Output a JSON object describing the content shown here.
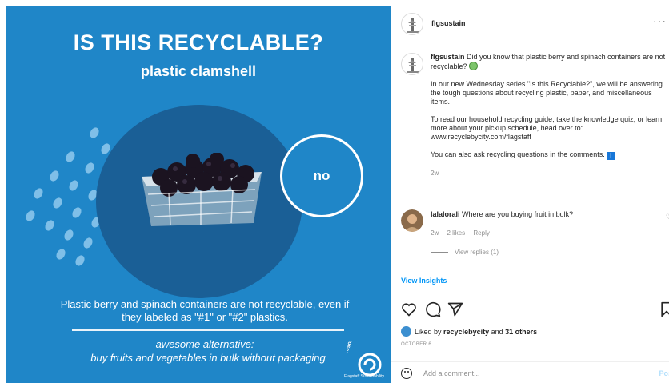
{
  "post_image": {
    "headline": "IS THIS RECYCLABLE?",
    "subhead": "plastic clamshell",
    "answer": "no",
    "description": "Plastic berry and spinach containers are not recyclable, even if they labeled as \"#1\" or \"#2\" plastics.",
    "alternative_title": "awesome alternative:",
    "alternative_text": "buy fruits and vegetables in bulk without packaging",
    "brand_logo_text": "be resourceful",
    "brand_name": "Flagstaff Sustainability",
    "colors": {
      "background": "#1f86c8",
      "blob": "#1a5f96",
      "text": "#ffffff"
    }
  },
  "header": {
    "username": "flgsustain",
    "more_icon": "more-icon"
  },
  "caption": {
    "username": "flgsustain",
    "line1": "Did you know that plastic berry and spinach containers are not recyclable?",
    "para2": "In our new Wednesday series \"Is this Recyclable?\", we will be answering the tough questions about recycling plastic, paper, and miscellaneous items.",
    "para3": "To read our household recycling guide, take the knowledge quiz, or learn more about your pickup schedule, head over to: www.recyclebycity.com/flagstaff",
    "para4": "You can also ask recycling questions in the comments.",
    "info_glyph": "i",
    "age": "2w"
  },
  "comment": {
    "username": "lalalorali",
    "text": "Where are you buying fruit in bulk?",
    "age": "2w",
    "likes": "2 likes",
    "reply": "Reply",
    "view_replies": "View replies (1)"
  },
  "view_insights": "View Insights",
  "likes_line": {
    "prefix": "Liked by",
    "user": "recyclebycity",
    "middle": "and",
    "others": "31 others"
  },
  "date": "OCTOBER 6",
  "add_comment": {
    "placeholder": "Add a comment...",
    "post_label": "Post"
  },
  "icons": [
    "heart-icon",
    "comment-icon",
    "share-icon",
    "bookmark-icon",
    "emoji-icon",
    "more-icon"
  ]
}
